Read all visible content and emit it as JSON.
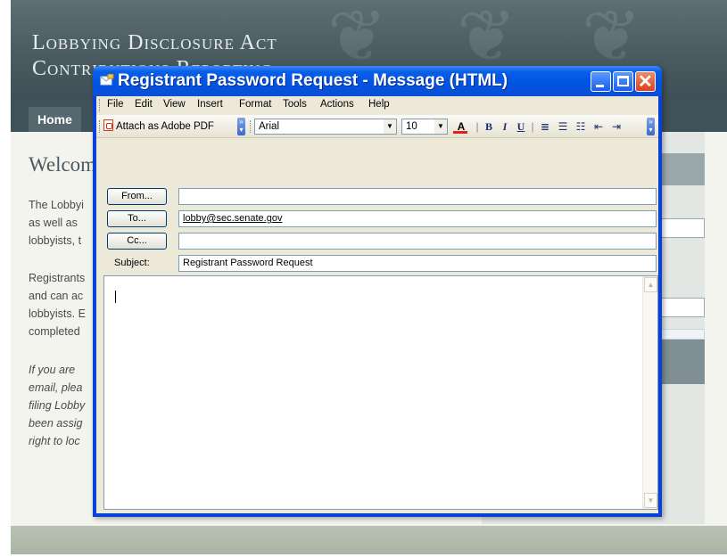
{
  "background_page": {
    "site_title": "Lobbying Disclosure Act\nContributions Reporting",
    "nav_home": "Home",
    "welcome": "Welcom",
    "para1": [
      "The Lobbyi",
      "as well as",
      "lobbyists, t"
    ],
    "para2": [
      "Registrants",
      "and can ac",
      "lobbyists. E",
      "completed"
    ],
    "para3": [
      "If you are",
      "email, plea",
      "filing Lobby",
      "been assig",
      "right to loc"
    ]
  },
  "window": {
    "title": "Registrant Password Request - Message (HTML)",
    "menu": {
      "file": "File",
      "edit": "Edit",
      "view": "View",
      "insert": "Insert",
      "format": "Format",
      "tools": "Tools",
      "actions": "Actions",
      "help": "Help"
    },
    "toolbar": {
      "attach": "Attach as Adobe PDF",
      "font": "Arial",
      "size": "10",
      "bold": "B",
      "italic": "I",
      "underline": "U",
      "font_color": "A"
    },
    "header": {
      "from_button": "From...",
      "to_button": "To...",
      "cc_button": "Cc...",
      "from_value": "",
      "to_value": "lobby@sec.senate.gov",
      "cc_value": "",
      "subject_label": "Subject:",
      "subject_value": "Registrant Password Request"
    },
    "body_text": ""
  },
  "colors": {
    "titlebar": "#0054e3",
    "window_chrome": "#ece9d8",
    "site_banner": "#4a5b61",
    "close_button": "#d8431c"
  }
}
